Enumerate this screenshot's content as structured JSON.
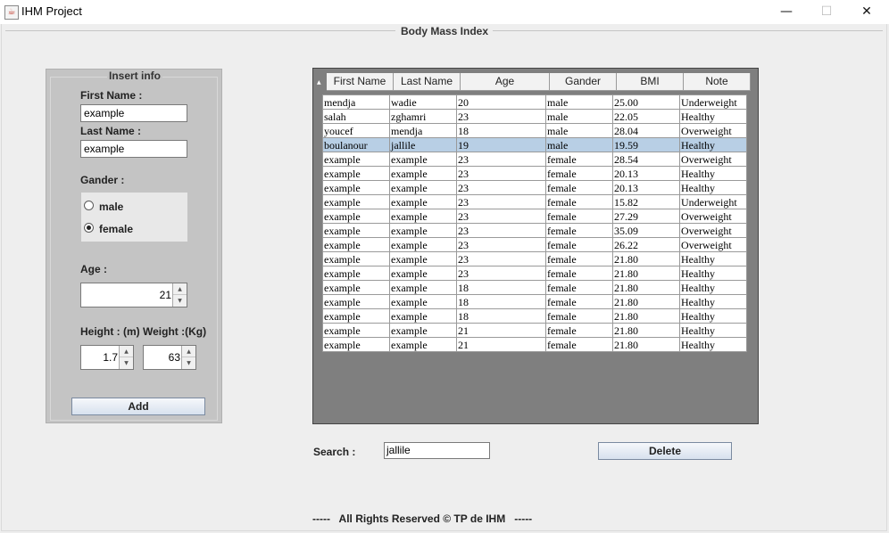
{
  "window": {
    "title": "IHM Project",
    "minimize": "—",
    "maximize": "☐",
    "close": "✕",
    "app_icon": "java-coffee-icon"
  },
  "main_group": {
    "title": "Body Mass Index"
  },
  "insert_panel": {
    "title": "Insert info",
    "first_name_label": "First Name :",
    "first_name_value": "example",
    "last_name_label": "Last Name :",
    "last_name_value": "example",
    "gender_label": "Gander :",
    "gender_options": [
      {
        "label": "male",
        "selected": false
      },
      {
        "label": "female",
        "selected": true
      }
    ],
    "age_label": "Age :",
    "age_value": "21",
    "height_label": "Height : (m)",
    "weight_label": "Weight :(Kg)",
    "height_value": "1.7",
    "weight_value": "63",
    "add_button": "Add"
  },
  "table": {
    "columns": [
      "First Name",
      "Last Name",
      "Age",
      "Gander",
      "BMI",
      "Note"
    ],
    "rows": [
      [
        "mendja",
        "wadie",
        "20",
        "male",
        "25.00",
        "Underweight"
      ],
      [
        "salah",
        "zghamri",
        "23",
        "male",
        "22.05",
        "Healthy"
      ],
      [
        "youcef",
        "mendja",
        "18",
        "male",
        "28.04",
        "Overweight"
      ],
      [
        "boulanour",
        "jallile",
        "19",
        "male",
        "19.59",
        "Healthy"
      ],
      [
        "example",
        "example",
        "23",
        "female",
        "28.54",
        "Overweight"
      ],
      [
        "example",
        "example",
        "23",
        "female",
        "20.13",
        "Healthy"
      ],
      [
        "example",
        "example",
        "23",
        "female",
        "20.13",
        "Healthy"
      ],
      [
        "example",
        "example",
        "23",
        "female",
        "15.82",
        "Underweight"
      ],
      [
        "example",
        "example",
        "23",
        "female",
        "27.29",
        "Overweight"
      ],
      [
        "example",
        "example",
        "23",
        "female",
        "35.09",
        "Overweight"
      ],
      [
        "example",
        "example",
        "23",
        "female",
        "26.22",
        "Overweight"
      ],
      [
        "example",
        "example",
        "23",
        "female",
        "21.80",
        "Healthy"
      ],
      [
        "example",
        "example",
        "23",
        "female",
        "21.80",
        "Healthy"
      ],
      [
        "example",
        "example",
        "18",
        "female",
        "21.80",
        "Healthy"
      ],
      [
        "example",
        "example",
        "18",
        "female",
        "21.80",
        "Healthy"
      ],
      [
        "example",
        "example",
        "18",
        "female",
        "21.80",
        "Healthy"
      ],
      [
        "example",
        "example",
        "21",
        "female",
        "21.80",
        "Healthy"
      ],
      [
        "example",
        "example",
        "21",
        "female",
        "21.80",
        "Healthy"
      ]
    ],
    "selected_row": 3
  },
  "search": {
    "label": "Search :",
    "value": "jallile"
  },
  "delete_button": "Delete",
  "footer": "-----   All Rights Reserved © TP de IHM   -----"
}
